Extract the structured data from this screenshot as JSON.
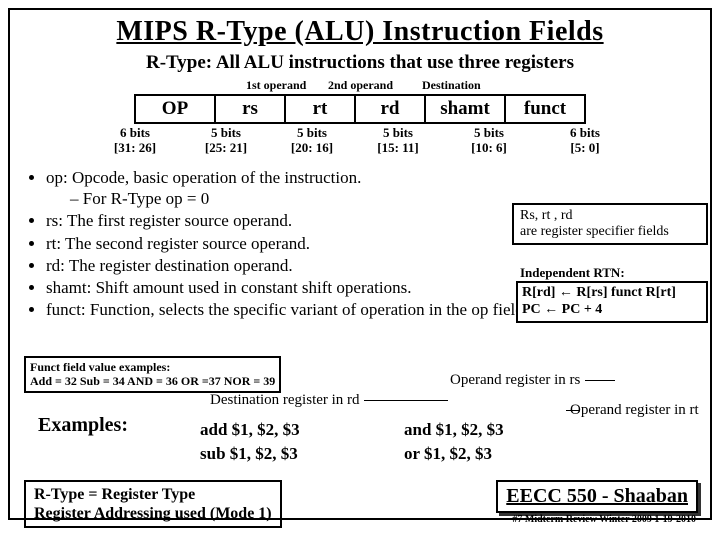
{
  "title": "MIPS R-Type (ALU) Instruction Fields",
  "subtitle": "R-Type:  All ALU instructions that use three registers",
  "headers": {
    "op1": "1st operand",
    "op2": "2nd operand",
    "dest": "Destination"
  },
  "fields": {
    "col0": {
      "name": "OP",
      "bits": "6 bits",
      "range": "[31: 26]"
    },
    "col1": {
      "name": "rs",
      "bits": "5 bits",
      "range": "[25: 21]"
    },
    "col2": {
      "name": "rt",
      "bits": "5 bits",
      "range": "[20: 16]"
    },
    "col3": {
      "name": "rd",
      "bits": "5 bits",
      "range": "[15: 11]"
    },
    "col4": {
      "name": "shamt",
      "bits": "5 bits",
      "range": "[10: 6]"
    },
    "col5": {
      "name": "funct",
      "bits": "6 bits",
      "range": "[5: 0]"
    }
  },
  "bul": {
    "op": "op: Opcode, basic operation of the instruction.",
    "opsub": "For R-Type  op = 0",
    "rs": "rs: The first register source operand.",
    "rt": "rt: The second register source operand.",
    "rd": "rd: The register destination operand.",
    "shamt": "shamt:  Shift amount used in constant shift operations.",
    "funct": "funct:  Function, selects the specific variant of operation in the op field."
  },
  "box1": {
    "l1": "Rs, rt  , rd",
    "l2": "are register specifier fields"
  },
  "indep": "Independent RTN:",
  "box2": {
    "l1": "R[rd] ←  R[rs]  funct  R[rt]",
    "l2": "PC  ←  PC + 4"
  },
  "functex": {
    "l1": "Funct field value examples:",
    "l2": "Add = 32  Sub = 34  AND = 36  OR =37  NOR = 39"
  },
  "destreg": "Destination register in rd",
  "oprs": "Operand register in rs",
  "oprt": "Operand register in rt",
  "exlabel": "Examples:",
  "ex1": {
    "a": "add $1, $2, $3",
    "b": "sub $1, $2, $3"
  },
  "ex2": {
    "a": "and $1, $2, $3",
    "b": "or  $1, $2, $3"
  },
  "rtype": {
    "l1": "R-Type =  Register Type",
    "l2": "Register Addressing used (Mode 1)"
  },
  "eecc": "EECC 550 - Shaaban",
  "footer": "#7   Midterm Review   Winter 2009  1-19-2010"
}
